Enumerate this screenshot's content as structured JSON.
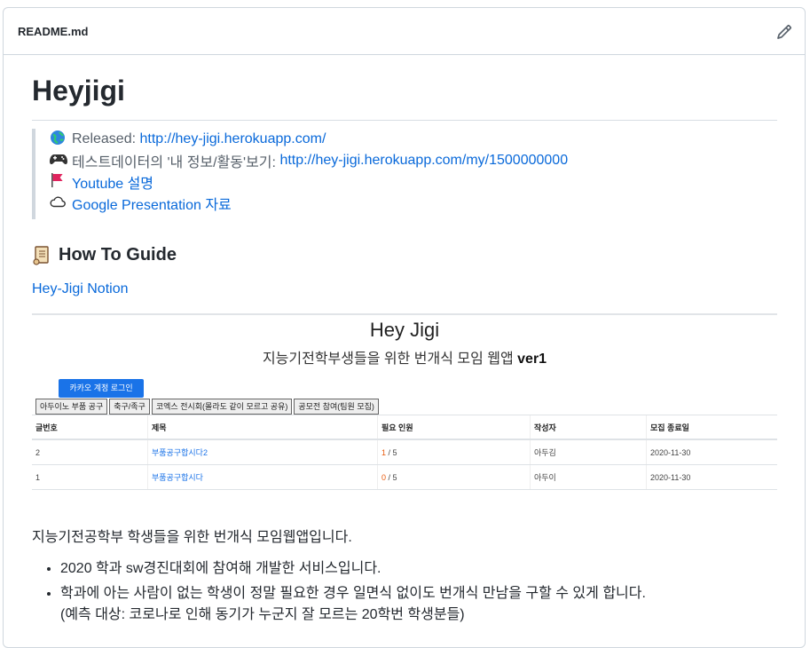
{
  "header": {
    "filename": "README.md"
  },
  "title": "Heyjigi",
  "quote": {
    "released_prefix": "Released: ",
    "released_url": "http://hey-jigi.herokuapp.com/",
    "testdata_prefix": "테스트데이터의 '내 정보/활동'보기: ",
    "testdata_url": "http://hey-jigi.herokuapp.com/my/1500000000",
    "youtube": "Youtube 설명",
    "google": "Google Presentation 자료",
    "icons": [
      "globe-icon",
      "gamepad-icon",
      "red-flag-icon",
      "cloud-icon"
    ]
  },
  "guide": {
    "heading": "How To Guide",
    "link": "Hey-Jigi Notion"
  },
  "app_shot": {
    "title": "Hey Jigi",
    "subtitle": "지능기전학부생들을 위한 번개식 모임 웹앱",
    "subtitle_bold": "ver1",
    "login_button": "카카오 계정 로그인",
    "categories": [
      "아두이노 부품 공구",
      "축구/족구",
      "코엑스 전시회(몰라도 같이 모르고 공유)",
      "공모전 참여(팀원 모집)"
    ],
    "columns": [
      "글번호",
      "제목",
      "필요 인원",
      "작성자",
      "모집 종료일"
    ],
    "rows": [
      {
        "no": "2",
        "title": "부품공구합시다2",
        "current": "1",
        "total": " / 5",
        "author": "아두김",
        "end": "2020-11-30"
      },
      {
        "no": "1",
        "title": "부품공구합시다",
        "current": "0",
        "total": " / 5",
        "author": "아두이",
        "end": "2020-11-30"
      }
    ]
  },
  "description": "지능기전공학부 학생들을 위한 번개식 모임웹앱입니다.",
  "bullets": [
    "2020 학과 sw경진대회에 참여해 개발한 서비스입니다.",
    "학과에 아는 사람이 없는 학생이 정말 필요한 경우 일면식 없이도 번개식 만남을 구할 수 있게 합니다.",
    "(예측 대상: 코로나로 인해 동기가 누군지 잘 모르는 20학번 학생분들)"
  ]
}
